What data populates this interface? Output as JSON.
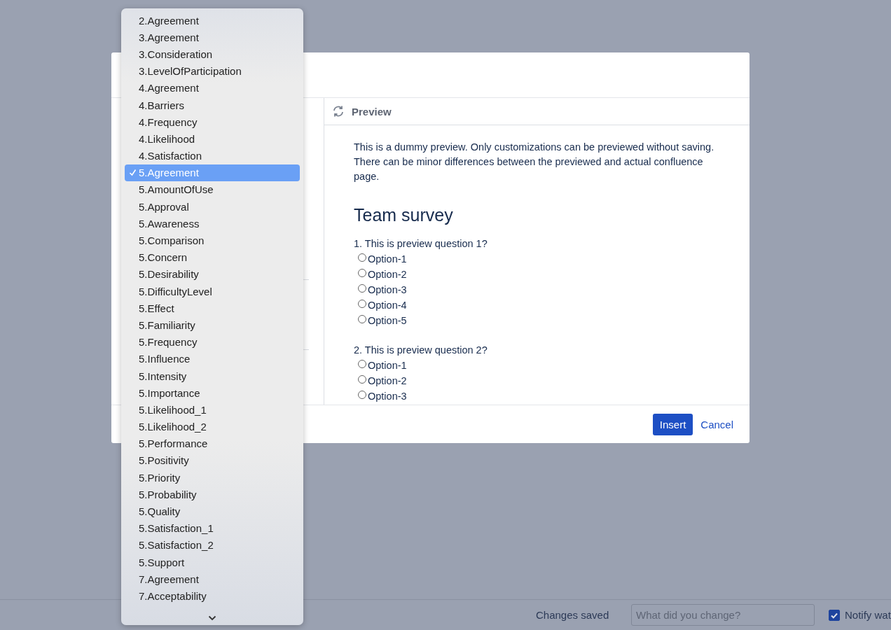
{
  "dialog": {
    "preview": {
      "title": "Preview",
      "notice": "This is a dummy preview. Only customizations can be previewed without saving. There can be minor differences between the previewed and actual confluence page.",
      "survey_title": "Team survey",
      "questions": [
        {
          "text": "1. This is preview question 1?",
          "options": [
            {
              "label": "Option-1",
              "selected": false
            },
            {
              "label": "Option-2",
              "selected": false
            },
            {
              "label": "Option-3",
              "selected": false
            },
            {
              "label": "Option-4",
              "selected": false
            },
            {
              "label": "Option-5",
              "selected": false
            }
          ]
        },
        {
          "text": "2. This is preview question 2?",
          "options": [
            {
              "label": "Option-1",
              "selected": false
            },
            {
              "label": "Option-2",
              "selected": false
            },
            {
              "label": "Option-3",
              "selected": false
            }
          ]
        }
      ]
    },
    "buttons": [
      {
        "label": "Insert",
        "kind": "primary"
      },
      {
        "label": "Cancel",
        "kind": "link"
      }
    ]
  },
  "dropdown": {
    "items": [
      {
        "label": "2.Agreement",
        "selected": false
      },
      {
        "label": "3.Agreement",
        "selected": false
      },
      {
        "label": "3.Consideration",
        "selected": false
      },
      {
        "label": "3.LevelOfParticipation",
        "selected": false
      },
      {
        "label": "4.Agreement",
        "selected": false
      },
      {
        "label": "4.Barriers",
        "selected": false
      },
      {
        "label": "4.Frequency",
        "selected": false
      },
      {
        "label": "4.Likelihood",
        "selected": false
      },
      {
        "label": "4.Satisfaction",
        "selected": false
      },
      {
        "label": "5.Agreement",
        "selected": true
      },
      {
        "label": "5.AmountOfUse",
        "selected": false
      },
      {
        "label": "5.Approval",
        "selected": false
      },
      {
        "label": "5.Awareness",
        "selected": false
      },
      {
        "label": "5.Comparison",
        "selected": false
      },
      {
        "label": "5.Concern",
        "selected": false
      },
      {
        "label": "5.Desirability",
        "selected": false
      },
      {
        "label": "5.DifficultyLevel",
        "selected": false
      },
      {
        "label": "5.Effect",
        "selected": false
      },
      {
        "label": "5.Familiarity",
        "selected": false
      },
      {
        "label": "5.Frequency",
        "selected": false
      },
      {
        "label": "5.Influence",
        "selected": false
      },
      {
        "label": "5.Intensity",
        "selected": false
      },
      {
        "label": "5.Importance",
        "selected": false
      },
      {
        "label": "5.Likelihood_1",
        "selected": false
      },
      {
        "label": "5.Likelihood_2",
        "selected": false
      },
      {
        "label": "5.Performance",
        "selected": false
      },
      {
        "label": "5.Positivity",
        "selected": false
      },
      {
        "label": "5.Priority",
        "selected": false
      },
      {
        "label": "5.Probability",
        "selected": false
      },
      {
        "label": "5.Quality",
        "selected": false
      },
      {
        "label": "5.Satisfaction_1",
        "selected": false
      },
      {
        "label": "5.Satisfaction_2",
        "selected": false
      },
      {
        "label": "5.Support",
        "selected": false
      },
      {
        "label": "7.Agreement",
        "selected": false
      },
      {
        "label": "7.Acceptability",
        "selected": false
      }
    ]
  },
  "status_bar": {
    "status": "Changes saved",
    "comment_field": {
      "placeholder": "What did you change?"
    },
    "notify": {
      "label": "Notify wat",
      "checked": true
    }
  }
}
